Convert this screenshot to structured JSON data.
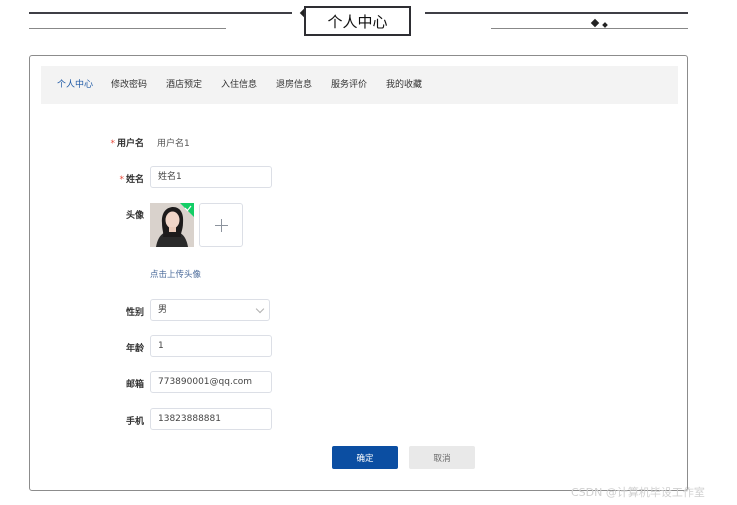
{
  "header": {
    "title": "个人中心"
  },
  "tabs": [
    {
      "label": "个人中心",
      "active": true
    },
    {
      "label": "修改密码",
      "active": false
    },
    {
      "label": "酒店预定",
      "active": false
    },
    {
      "label": "入住信息",
      "active": false
    },
    {
      "label": "退房信息",
      "active": false
    },
    {
      "label": "服务评价",
      "active": false
    },
    {
      "label": "我的收藏",
      "active": false
    }
  ],
  "form": {
    "username": {
      "label": "用户名",
      "required_mark": "*",
      "value": "用户名1"
    },
    "name": {
      "label": "姓名",
      "required_mark": "*",
      "value": "姓名1"
    },
    "avatar": {
      "label": "头像",
      "upload_hint": "点击上传头像"
    },
    "gender": {
      "label": "性别",
      "value": "男"
    },
    "age": {
      "label": "年龄",
      "value": "1"
    },
    "email": {
      "label": "邮箱",
      "value": "773890001@qq.com"
    },
    "phone": {
      "label": "手机",
      "value": "13823888881"
    }
  },
  "buttons": {
    "confirm": "确定",
    "cancel": "取消"
  },
  "watermark": "CSDN @计算机毕设工作室",
  "colors": {
    "accent": "#0b4ea2",
    "active_tab": "#1f5aa6",
    "required": "#e74c3c",
    "upload_success": "#13ce66"
  }
}
